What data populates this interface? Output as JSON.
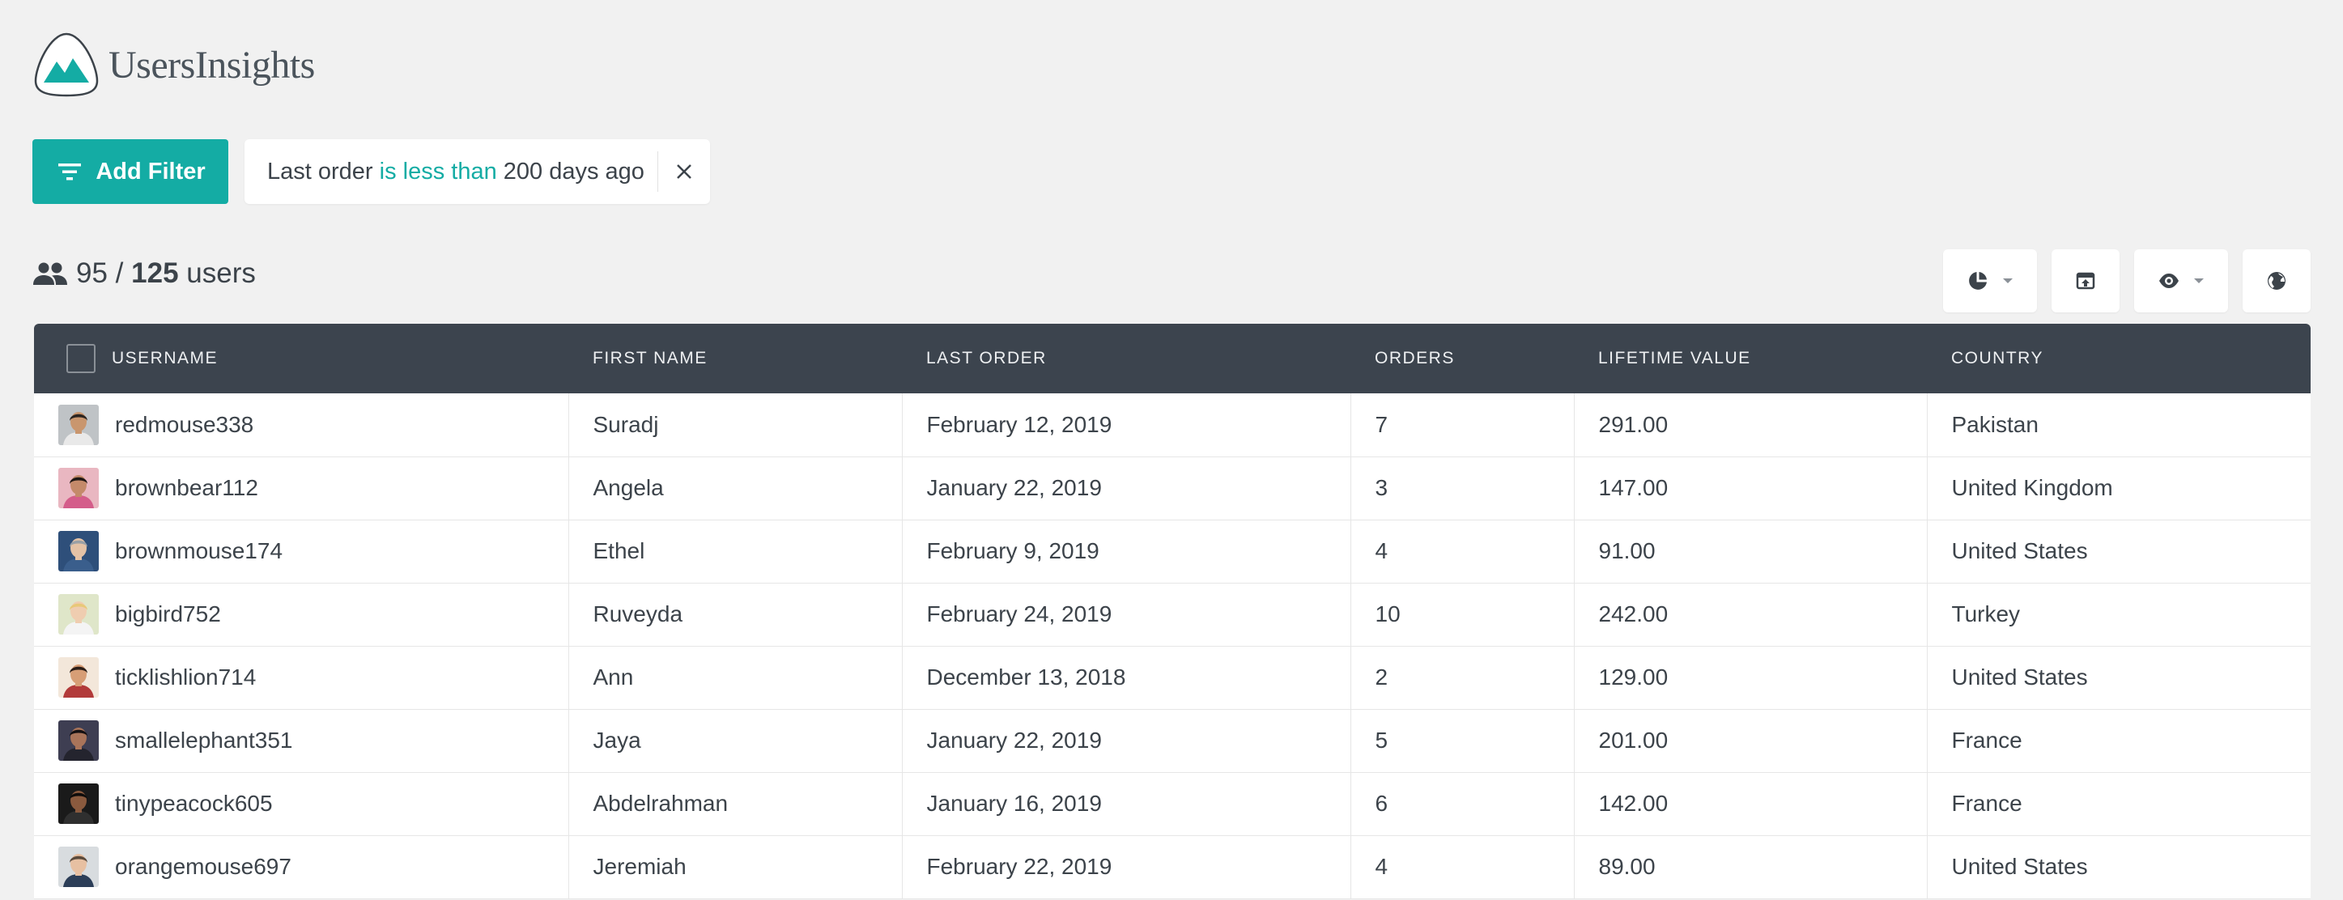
{
  "brand": {
    "name": "UsersInsights",
    "accent": "#14aca4"
  },
  "filter_bar": {
    "add_label": "Add Filter",
    "filter": {
      "field": "Last order",
      "operator": "is less than",
      "value": "200 days ago"
    }
  },
  "summary": {
    "filtered": "95",
    "separator": "/",
    "total": "125",
    "unit": "users"
  },
  "toolbar": {
    "icons": [
      "pie-chart-icon",
      "export-icon",
      "eye-icon",
      "globe-icon"
    ]
  },
  "table": {
    "columns": [
      "USERNAME",
      "FIRST NAME",
      "LAST ORDER",
      "ORDERS",
      "LIFETIME VALUE",
      "COUNTRY"
    ],
    "rows": [
      {
        "username": "redmouse338",
        "first_name": "Suradj",
        "last_order": "February 12, 2019",
        "orders": "7",
        "ltv": "291.00",
        "country": "Pakistan",
        "avatar": {
          "bg": "#bfc3c6",
          "skin": "#c9966e",
          "hair": "#2b2420",
          "shirt": "#e9e9e9"
        }
      },
      {
        "username": "brownbear112",
        "first_name": "Angela",
        "last_order": "January 22, 2019",
        "orders": "3",
        "ltv": "147.00",
        "country": "United Kingdom",
        "avatar": {
          "bg": "#e9b7c1",
          "skin": "#c48a6a",
          "hair": "#1f1714",
          "shirt": "#d45d8a"
        }
      },
      {
        "username": "brownmouse174",
        "first_name": "Ethel",
        "last_order": "February 9, 2019",
        "orders": "4",
        "ltv": "91.00",
        "country": "United States",
        "avatar": {
          "bg": "#2e4f7a",
          "skin": "#e4c2a6",
          "hair": "#9aa0a6",
          "shirt": "#3a5e8c"
        }
      },
      {
        "username": "bigbird752",
        "first_name": "Ruveyda",
        "last_order": "February 24, 2019",
        "orders": "10",
        "ltv": "242.00",
        "country": "Turkey",
        "avatar": {
          "bg": "#dfe6c9",
          "skin": "#efcdb0",
          "hair": "#e8c878",
          "shirt": "#f4f4f4"
        }
      },
      {
        "username": "ticklishlion714",
        "first_name": "Ann",
        "last_order": "December 13, 2018",
        "orders": "2",
        "ltv": "129.00",
        "country": "United States",
        "avatar": {
          "bg": "#f3e7da",
          "skin": "#d79e76",
          "hair": "#2a1d17",
          "shirt": "#b23a3a"
        }
      },
      {
        "username": "smallelephant351",
        "first_name": "Jaya",
        "last_order": "January 22, 2019",
        "orders": "5",
        "ltv": "201.00",
        "country": "France",
        "avatar": {
          "bg": "#3e3e52",
          "skin": "#a9745a",
          "hair": "#141012",
          "shirt": "#24242e"
        }
      },
      {
        "username": "tinypeacock605",
        "first_name": "Abdelrahman",
        "last_order": "January 16, 2019",
        "orders": "6",
        "ltv": "142.00",
        "country": "France",
        "avatar": {
          "bg": "#1a1a1a",
          "skin": "#8a5a3e",
          "hair": "#0e0c0b",
          "shirt": "#2f2f2f"
        }
      },
      {
        "username": "orangemouse697",
        "first_name": "Jeremiah",
        "last_order": "February 22, 2019",
        "orders": "4",
        "ltv": "89.00",
        "country": "United States",
        "avatar": {
          "bg": "#d8dcdf",
          "skin": "#e7c0a2",
          "hair": "#5a4a3c",
          "shirt": "#2c3e58"
        }
      }
    ]
  }
}
